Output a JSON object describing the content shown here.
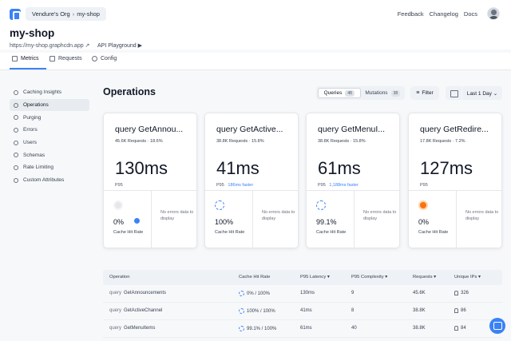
{
  "header": {
    "org": "Vendure's Org",
    "separator": "›",
    "project": "my-shop",
    "links": [
      "Feedback",
      "Changelog",
      "Docs"
    ]
  },
  "project": {
    "title": "my-shop",
    "url": "https://my-shop.graphcdn.app ↗",
    "playground": "API Playground ▶"
  },
  "tabs": [
    "Metrics",
    "Requests",
    "Config"
  ],
  "sidebar": {
    "items": [
      "Caching Insights",
      "Operations",
      "Purging",
      "Errors",
      "Users",
      "Schemas",
      "Rate Limiting",
      "Custom Attributes"
    ]
  },
  "main": {
    "title": "Operations",
    "segments": [
      {
        "label": "Queries",
        "count": "48"
      },
      {
        "label": "Mutations",
        "count": "38"
      }
    ],
    "filter": "Filter",
    "range": "Last 1 Day ⌄"
  },
  "cards": [
    {
      "name": "query GetAnnou...",
      "sub": "45.6K Requests · 18.6%",
      "metric": "130ms",
      "p95": "P95",
      "faster": "",
      "hit": "0%",
      "hit_label": "Cache Hit Rate",
      "errors": "No errors data to display"
    },
    {
      "name": "query GetActive...",
      "sub": "38.8K Requests · 15.8%",
      "metric": "41ms",
      "p95": "P95",
      "faster": "186ms faster",
      "hit": "100%",
      "hit_label": "Cache Hit Rate",
      "errors": "No errors data to display"
    },
    {
      "name": "query GetMenuI...",
      "sub": "38.8K Requests · 15.8%",
      "metric": "61ms",
      "p95": "P95",
      "faster": "1,188ms faster",
      "hit": "99.1%",
      "hit_label": "Cache Hit Rate",
      "errors": "No errors data to display"
    },
    {
      "name": "query GetRedire...",
      "sub": "17.8K Requests · 7.2%",
      "metric": "127ms",
      "p95": "P95",
      "faster": "",
      "hit": "0%",
      "hit_label": "Cache Hit Rate",
      "errors": "No errors data to display"
    }
  ],
  "table": {
    "headers": [
      "Operation",
      "Cache Hit Rate",
      "P95 Latency ▾",
      "P95 Complexity ▾",
      "Requests ▾",
      "Unique IPs ▾"
    ],
    "rows": [
      {
        "kw": "query",
        "name": "GetAnnouncements",
        "hit": "0% / 100%",
        "latency": "130ms",
        "complexity": "9",
        "requests": "45.6K",
        "ips": "326"
      },
      {
        "kw": "query",
        "name": "GetActiveChannel",
        "hit": "100% / 100%",
        "latency": "41ms",
        "complexity": "8",
        "requests": "38.8K",
        "ips": "86"
      },
      {
        "kw": "query",
        "name": "GetMenuItems",
        "hit": "99.1% / 100%",
        "latency": "61ms",
        "complexity": "40",
        "requests": "38.8K",
        "ips": "84"
      }
    ]
  }
}
